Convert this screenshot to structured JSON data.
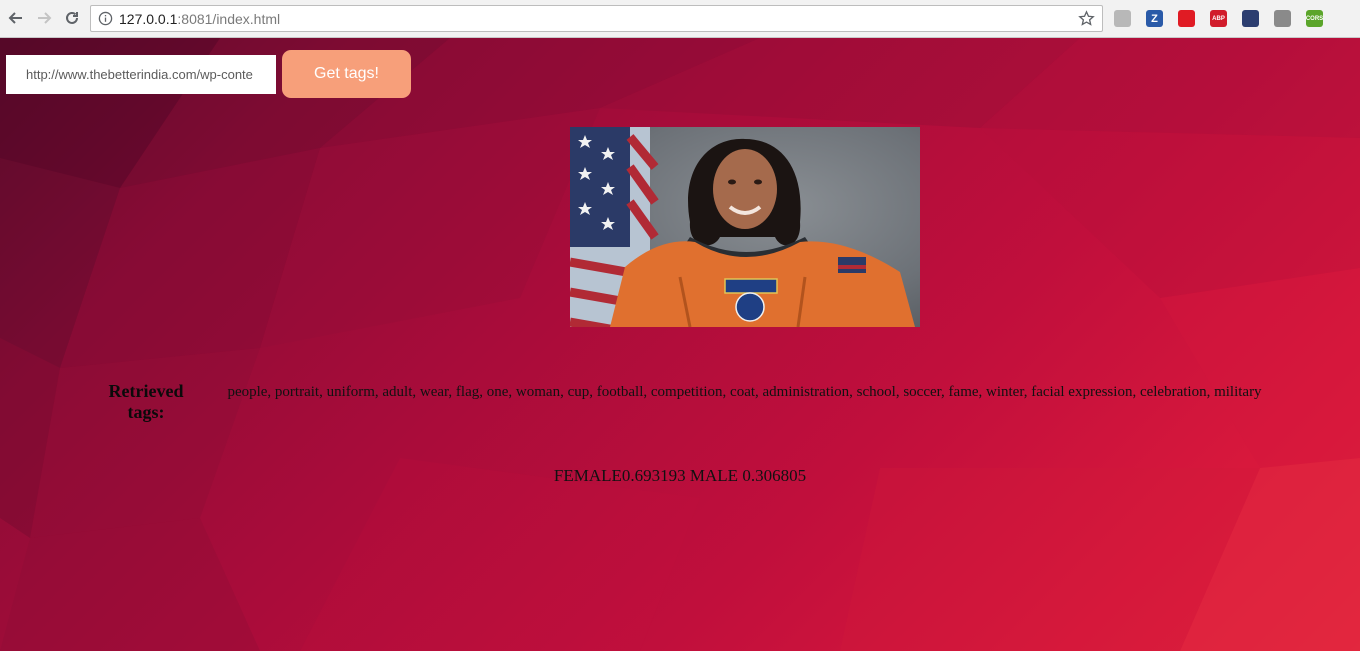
{
  "browser": {
    "url_host": "127.0.0.1",
    "url_rest": ":8081/index.html",
    "extensions": [
      {
        "icon": "pdf-extension-icon",
        "label": "",
        "color": "#b8b8b8"
      },
      {
        "icon": "zotero-extension-icon",
        "label": "Z",
        "color": "#2a5aa8"
      },
      {
        "icon": "opera-extension-icon",
        "label": "",
        "color": "#e01b24"
      },
      {
        "icon": "adblock-plus-icon",
        "label": "ABP",
        "color": "#d11c2b"
      },
      {
        "icon": "mountain-extension-icon",
        "label": "",
        "color": "#2c3e70"
      },
      {
        "icon": "toggle-extension-icon",
        "label": "",
        "color": "#8a8a8a"
      },
      {
        "icon": "cors-extension-icon",
        "label": "CORS",
        "color": "#5ba52a"
      }
    ]
  },
  "form": {
    "url_value": "http://www.thebetterindia.com/wp-conte",
    "button_label": "Get tags!"
  },
  "results": {
    "tags_label": "Retrieved tags:",
    "tags": "people, portrait, uniform, adult, wear, flag, one, woman, cup, football, competition, coat, administration, school, soccer, fame, winter, facial expression, celebration, military",
    "gender": "FEMALE0.693193 MALE 0.306805"
  },
  "colors": {
    "button": "#f79f7a",
    "background": "#b0103a"
  }
}
